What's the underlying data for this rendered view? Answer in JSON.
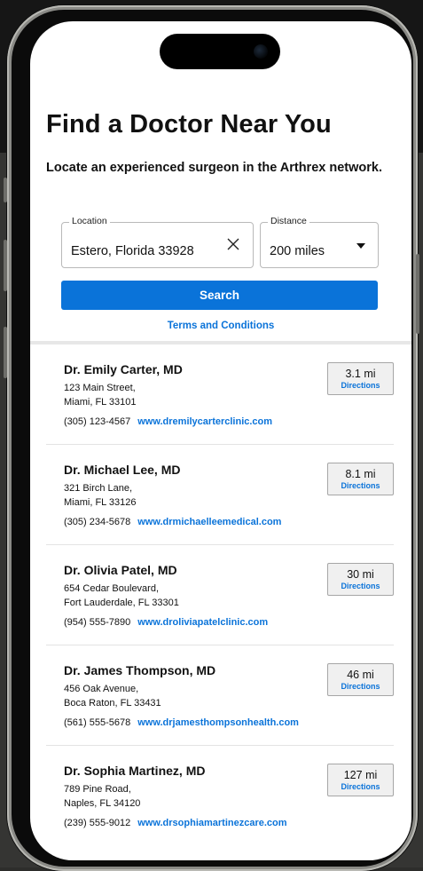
{
  "page": {
    "title": "Find a Doctor Near You",
    "subtitle": "Locate an experienced surgeon in the Arthrex network."
  },
  "search": {
    "location_label": "Location",
    "location_value": "Estero, Florida 33928",
    "distance_label": "Distance",
    "distance_value": "200 miles",
    "button_label": "Search",
    "terms_label": "Terms and Conditions"
  },
  "results": [
    {
      "name": "Dr. Emily Carter, MD",
      "address1": "123 Main Street,",
      "address2": "Miami, FL 33101",
      "phone": "(305) 123-4567",
      "website": "www.dremilycarterclinic.com",
      "distance": "3.1 mi",
      "directions": "Directions"
    },
    {
      "name": "Dr. Michael Lee, MD",
      "address1": "321 Birch Lane,",
      "address2": "Miami, FL 33126",
      "phone": "(305) 234-5678",
      "website": "www.drmichaelleemedical.com",
      "distance": "8.1 mi",
      "directions": "Directions"
    },
    {
      "name": "Dr. Olivia Patel, MD",
      "address1": "654 Cedar Boulevard,",
      "address2": "Fort Lauderdale, FL 33301",
      "phone": "(954) 555-7890",
      "website": "www.droliviapatelclinic.com",
      "distance": "30 mi",
      "directions": "Directions"
    },
    {
      "name": "Dr. James Thompson, MD",
      "address1": "456 Oak Avenue,",
      "address2": "Boca Raton, FL 33431",
      "phone": "(561) 555-5678",
      "website": "www.drjamesthompsonhealth.com",
      "distance": "46 mi",
      "directions": "Directions"
    },
    {
      "name": "Dr. Sophia Martinez, MD",
      "address1": "789 Pine Road,",
      "address2": "Naples, FL 34120",
      "phone": "(239) 555-9012",
      "website": "www.drsophiamartinezcare.com",
      "distance": "127 mi",
      "directions": "Directions"
    }
  ],
  "icons": {
    "clear": "close-icon",
    "dropdown": "chevron-down-icon"
  },
  "colors": {
    "accent": "#0a73d9",
    "text": "#111111",
    "background": "#ffffff"
  }
}
